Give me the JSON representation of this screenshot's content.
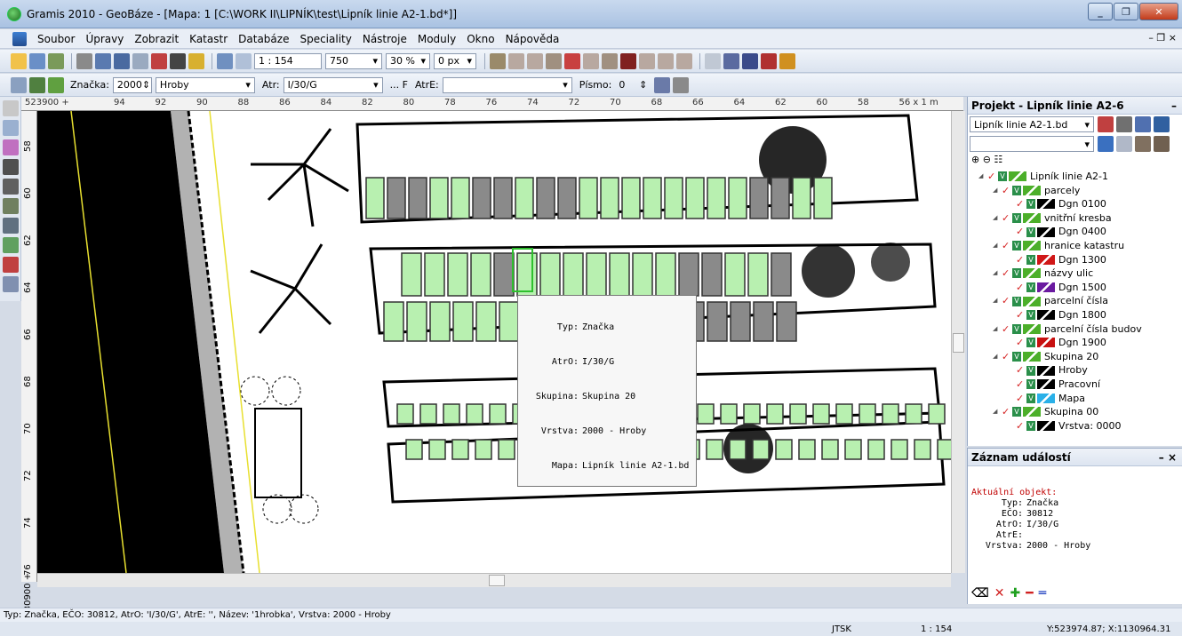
{
  "window": {
    "title": "Gramis 2010 - GeoBáze - [Mapa: 1 [C:\\WORK II\\LIPNÍK\\test\\Lipník linie A2-1.bd*]]",
    "buttons": [
      "_",
      "❐",
      "✕"
    ]
  },
  "menu": {
    "items": [
      "Soubor",
      "Úpravy",
      "Zobrazit",
      "Katastr",
      "Databáze",
      "Speciality",
      "Nástroje",
      "Moduly",
      "Okno",
      "Nápověda"
    ],
    "mdi_controls": "– ❐ ×"
  },
  "toolbar1": {
    "scale": "1 : 154",
    "value750": "750",
    "zoom": "30 %",
    "px": "0 px"
  },
  "toolbar2": {
    "znacka_label": "Značka:",
    "znacka_value": "2000",
    "layer_name": "Hroby",
    "atr_label": "Atr:",
    "atr_value": "I/30/G",
    "f_label": "... F",
    "atre_label": "AtrE:",
    "pismo_label": "Písmo:",
    "pismo_value": "0"
  },
  "ruler": {
    "top_start": "523900 +",
    "top_ticks": [
      "94",
      "92",
      "90",
      "88",
      "86",
      "84",
      "82",
      "80",
      "78",
      "76",
      "74",
      "72",
      "70",
      "68",
      "66",
      "64",
      "62",
      "60",
      "58",
      "56 x 1 m"
    ],
    "left_ticks": [
      "58",
      "60",
      "62",
      "64",
      "66",
      "68",
      "70",
      "72",
      "74",
      "76",
      "1130900 +"
    ]
  },
  "tooltip": {
    "rows": [
      {
        "k": "Typ:",
        "v": "Značka"
      },
      {
        "k": "AtrO:",
        "v": "I/30/G"
      },
      {
        "k": "Skupina:",
        "v": "Skupina 20"
      },
      {
        "k": "Vrstva:",
        "v": "2000 - Hroby"
      },
      {
        "k": "Mapa:",
        "v": "Lipník linie A2-1.bd"
      }
    ]
  },
  "project_panel": {
    "title": "Projekt - Lipník linie A2-6",
    "file_select": "Lipník linie A2-1.bd",
    "tree": [
      {
        "indent": 0,
        "label": "Lipník linie A2-1",
        "color": "#4caf2a"
      },
      {
        "indent": 1,
        "label": "parcely",
        "color": "#4caf2a"
      },
      {
        "indent": 2,
        "label": "Dgn 0100",
        "color": "#000000"
      },
      {
        "indent": 1,
        "label": "vnitřní kresba",
        "color": "#4caf2a"
      },
      {
        "indent": 2,
        "label": "Dgn 0400",
        "color": "#000000"
      },
      {
        "indent": 1,
        "label": "hranice katastru",
        "color": "#4caf2a"
      },
      {
        "indent": 2,
        "label": "Dgn 1300",
        "color": "#d01818"
      },
      {
        "indent": 1,
        "label": "názvy ulic",
        "color": "#4caf2a"
      },
      {
        "indent": 2,
        "label": "Dgn 1500",
        "color": "#6a1aa0"
      },
      {
        "indent": 1,
        "label": "parcelní čísla",
        "color": "#4caf2a"
      },
      {
        "indent": 2,
        "label": "Dgn 1800",
        "color": "#000000"
      },
      {
        "indent": 1,
        "label": "parcelní čísla budov",
        "color": "#4caf2a"
      },
      {
        "indent": 2,
        "label": "Dgn 1900",
        "color": "#c81010"
      },
      {
        "indent": 1,
        "label": "Skupina 20",
        "color": "#4caf2a"
      },
      {
        "indent": 2,
        "label": "Hroby",
        "color": "#000000"
      },
      {
        "indent": 2,
        "label": "Pracovní",
        "color": "#000000"
      },
      {
        "indent": 2,
        "label": "Mapa",
        "color": "#2ab0e8"
      },
      {
        "indent": 1,
        "label": "Skupina 00",
        "color": "#4caf2a"
      },
      {
        "indent": 2,
        "label": "Vrstva: 0000",
        "color": "#000000"
      }
    ]
  },
  "events_panel": {
    "title": "Záznam událostí",
    "header": "Aktuální objekt:",
    "lines": [
      {
        "k": "Typ:",
        "v": "Značka"
      },
      {
        "k": "EČO:",
        "v": "30812"
      },
      {
        "k": "AtrO:",
        "v": "I/30/G"
      },
      {
        "k": "AtrE:",
        "v": ""
      },
      {
        "k": "Vrstva:",
        "v": "2000 - Hroby"
      }
    ]
  },
  "status": {
    "line": "Typ: Značka, EČO: 30812, AtrO: 'I/30/G', AtrE: '', Název: '1hrobka', Vrstva: 2000 - Hroby",
    "crs": "JTSK",
    "scale": "1 : 154",
    "coords": "Y:523974.87; X:1130964.31"
  }
}
